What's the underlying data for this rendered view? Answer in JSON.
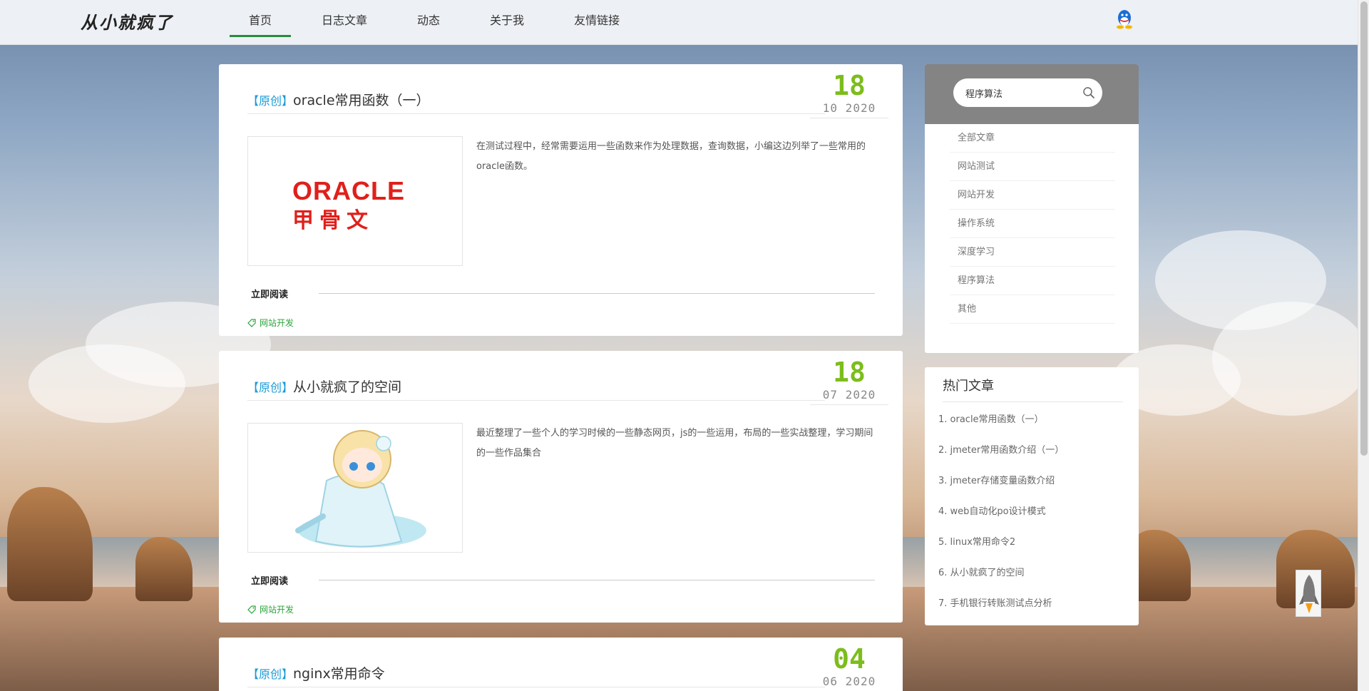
{
  "site": {
    "logo": "从小就疯了"
  },
  "nav": {
    "items": [
      {
        "label": "首页",
        "active": true
      },
      {
        "label": "日志文章",
        "active": false
      },
      {
        "label": "动态",
        "active": false
      },
      {
        "label": "关于我",
        "active": false
      },
      {
        "label": "友情链接",
        "active": false
      }
    ]
  },
  "articles": [
    {
      "tag": "【原创】",
      "title": "oracle常用函数（一）",
      "day": "18",
      "month_year": "10 2020",
      "summary": "在测试过程中，经常需要运用一些函数来作为处理数据，查询数据，小编这边列举了一些常用的oracle函数。",
      "thumb": {
        "logo_text": "ORACLE",
        "cn_text": "甲骨文"
      },
      "read_more": "立即阅读",
      "category": "网站开发"
    },
    {
      "tag": "【原创】",
      "title": "从小就疯了的空间",
      "day": "18",
      "month_year": "07 2020",
      "summary": "最近整理了一些个人的学习时候的一些静态网页，js的一些运用，布局的一些实战整理，学习期间的一些作品集合",
      "read_more": "立即阅读",
      "category": "网站开发"
    },
    {
      "tag": "【原创】",
      "title": "nginx常用命令",
      "day": "04",
      "month_year": "06 2020"
    }
  ],
  "sidebar": {
    "search": {
      "value": "程序算法"
    },
    "categories": [
      "全部文章",
      "网站测试",
      "网站开发",
      "操作系统",
      "深度学习",
      "程序算法",
      "其他"
    ],
    "hot": {
      "title": "热门文章",
      "items": [
        "1. oracle常用函数（一）",
        "2. jmeter常用函数介绍（一）",
        "3. jmeter存储变量函数介绍",
        "4. web自动化po设计模式",
        "5. linux常用命令2",
        "6. 从小就疯了的空间",
        "7. 手机银行转账测试点分析"
      ]
    }
  },
  "colors": {
    "accent_green": "#7cbd1c",
    "tag_blue": "#1a9bd7",
    "nav_active": "#2b8a3e"
  },
  "icons": {
    "qq": "qq-penguin-icon",
    "search": "search-icon",
    "tag": "tag-icon",
    "top": "rocket-icon"
  }
}
